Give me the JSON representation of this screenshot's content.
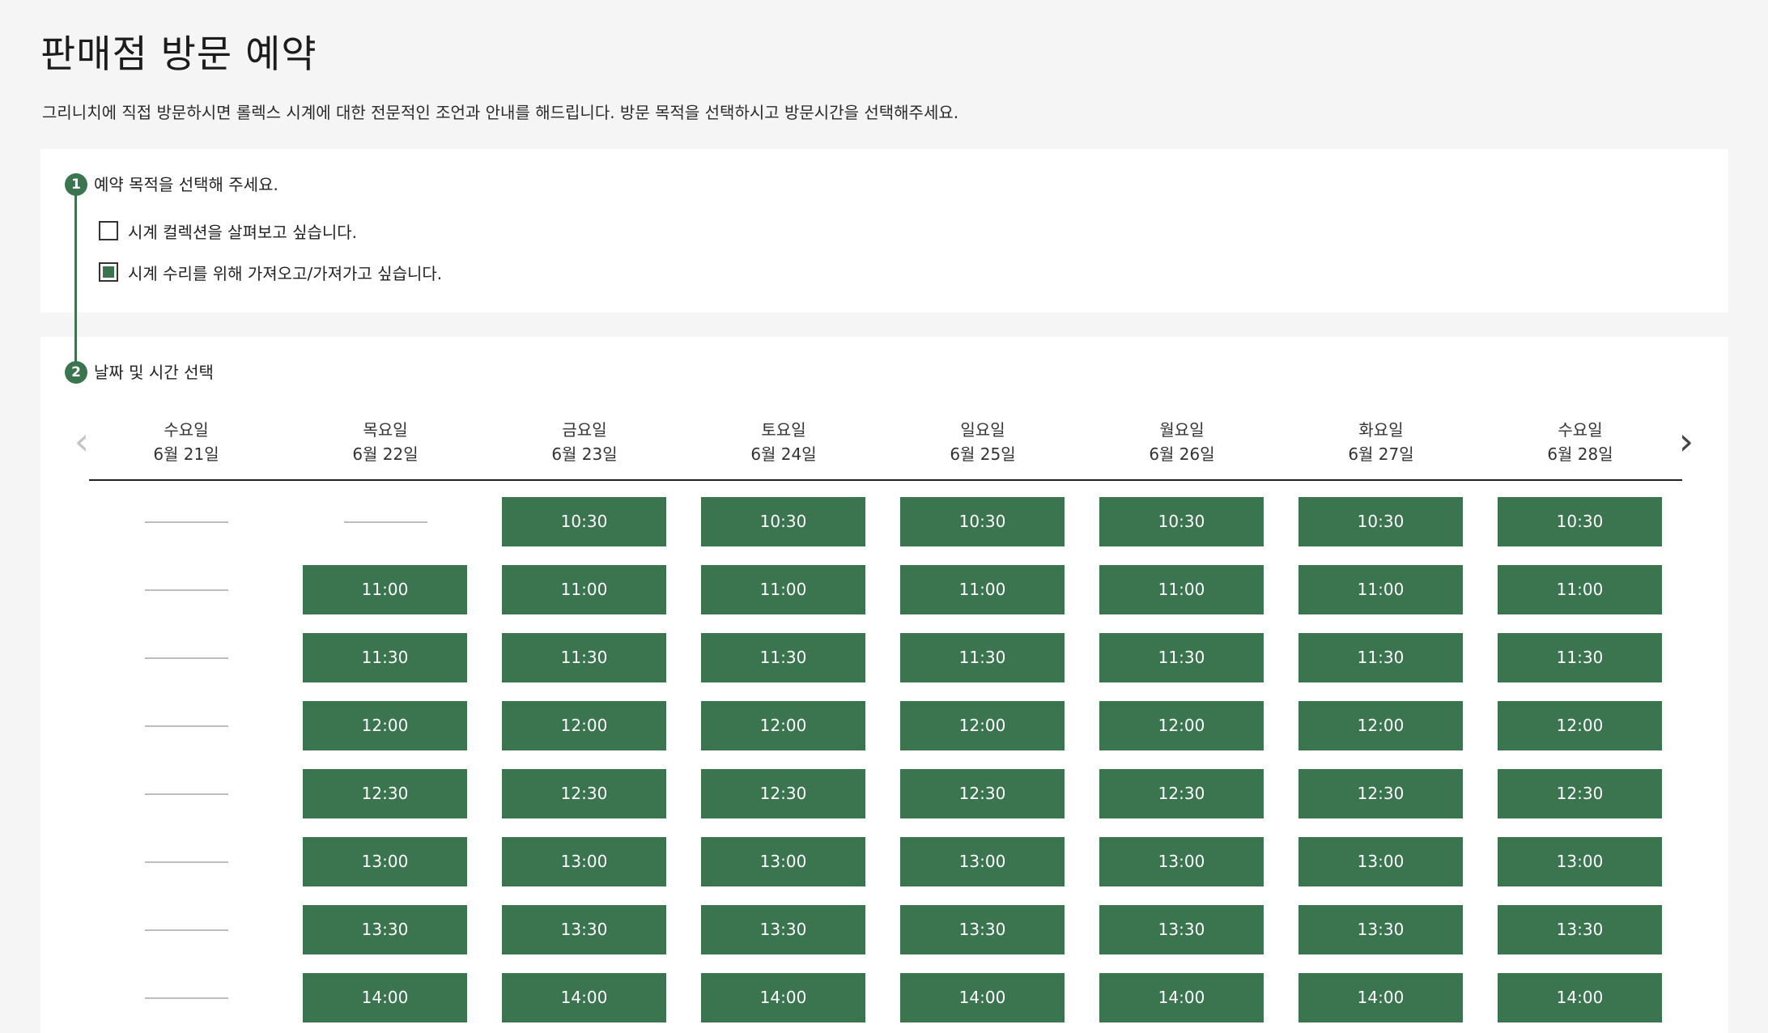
{
  "page": {
    "title": "판매점 방문 예약",
    "description": "그리니치에 직접 방문하시면 롤렉스 시계에 대한 전문적인 조언과 안내를 해드립니다. 방문 목적을 선택하시고 방문시간을 선택해주세요."
  },
  "steps": [
    {
      "number": "1",
      "title": "예약 목적을 선택해 주세요."
    },
    {
      "number": "2",
      "title": "날짜 및 시간 선택"
    }
  ],
  "purpose_options": [
    {
      "label": "시계 컬렉션을 살펴보고 싶습니다.",
      "checked": false
    },
    {
      "label": "시계 수리를 위해 가져오고/가져가고 싶습니다.",
      "checked": true
    }
  ],
  "navigation": {
    "prev": "‹",
    "next": "›"
  },
  "days": [
    {
      "weekday": "수요일",
      "date": "6월 21일",
      "slots": [
        null,
        null,
        null,
        null,
        null,
        null,
        null,
        null
      ]
    },
    {
      "weekday": "목요일",
      "date": "6월 22일",
      "slots": [
        null,
        "11:00",
        "11:30",
        "12:00",
        "12:30",
        "13:00",
        "13:30",
        "14:00"
      ]
    },
    {
      "weekday": "금요일",
      "date": "6월 23일",
      "slots": [
        "10:30",
        "11:00",
        "11:30",
        "12:00",
        "12:30",
        "13:00",
        "13:30",
        "14:00"
      ]
    },
    {
      "weekday": "토요일",
      "date": "6월 24일",
      "slots": [
        "10:30",
        "11:00",
        "11:30",
        "12:00",
        "12:30",
        "13:00",
        "13:30",
        "14:00"
      ]
    },
    {
      "weekday": "일요일",
      "date": "6월 25일",
      "slots": [
        "10:30",
        "11:00",
        "11:30",
        "12:00",
        "12:30",
        "13:00",
        "13:30",
        "14:00"
      ]
    },
    {
      "weekday": "월요일",
      "date": "6월 26일",
      "slots": [
        "10:30",
        "11:00",
        "11:30",
        "12:00",
        "12:30",
        "13:00",
        "13:30",
        "14:00"
      ]
    },
    {
      "weekday": "화요일",
      "date": "6월 27일",
      "slots": [
        "10:30",
        "11:00",
        "11:30",
        "12:00",
        "12:30",
        "13:00",
        "13:30",
        "14:00"
      ]
    },
    {
      "weekday": "수요일",
      "date": "6월 28일",
      "slots": [
        "10:30",
        "11:00",
        "11:30",
        "12:00",
        "12:30",
        "13:00",
        "13:30",
        "14:00"
      ]
    }
  ],
  "colors": {
    "accent": "#3a7550",
    "page_background": "#f5f5f5",
    "card_background": "#ffffff"
  }
}
